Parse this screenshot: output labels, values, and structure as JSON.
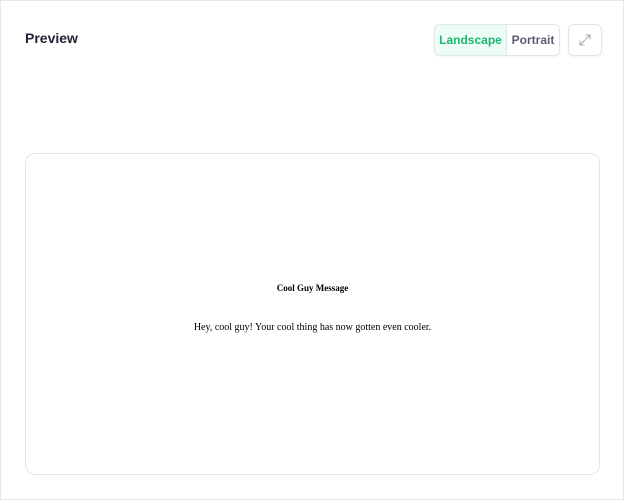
{
  "header": {
    "title": "Preview"
  },
  "orientation": {
    "landscape_label": "Landscape",
    "portrait_label": "Portrait",
    "selected": "Landscape"
  },
  "expand": {
    "icon": "expand-icon"
  },
  "preview": {
    "message_title": "Cool Guy Message",
    "message_body": "Hey, cool guy! Your cool thing has now gotten even cooler."
  },
  "colors": {
    "accent": "#22b573",
    "accent_bg": "#ecfdf5",
    "text": "#1f2430",
    "muted": "#5b6170",
    "border": "#e3e5e8"
  }
}
